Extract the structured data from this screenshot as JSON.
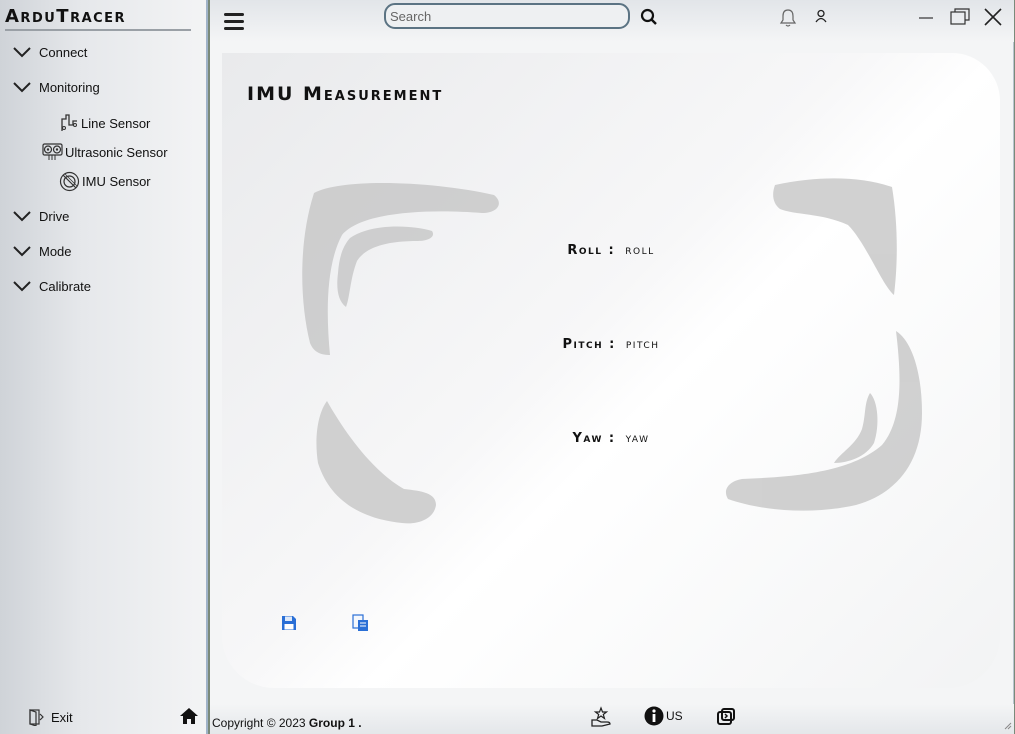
{
  "app": {
    "brand": "ArduTracer"
  },
  "sidebar": {
    "items": [
      {
        "label": "Connect",
        "icon": "chevron-down-icon"
      },
      {
        "label": "Monitoring",
        "icon": "chevron-down-icon"
      },
      {
        "label": "Drive",
        "icon": "chevron-down-icon"
      },
      {
        "label": "Mode",
        "icon": "chevron-down-icon"
      },
      {
        "label": "Calibrate",
        "icon": "chevron-down-icon"
      }
    ],
    "monitoring_sub": [
      {
        "label": "Line Sensor",
        "icon": "line-sensor-icon"
      },
      {
        "label": "Ultrasonic Sensor",
        "icon": "ultrasonic-sensor-icon"
      },
      {
        "label": "IMU Sensor",
        "icon": "imu-sensor-icon"
      }
    ],
    "exit_label": "Exit"
  },
  "topbar": {
    "search_placeholder": "Search",
    "search_value": ""
  },
  "panel": {
    "title": "IMU Measurement",
    "readings": [
      {
        "label": "Roll",
        "separator": ":",
        "value": "roll"
      },
      {
        "label": "Pitch",
        "separator": ":",
        "value": "pitch"
      },
      {
        "label": "Yaw",
        "separator": ":",
        "value": "yaw"
      }
    ]
  },
  "footer": {
    "copyright_prefix": "Copyright © 2023 ",
    "copyright_group": "Group 1 .",
    "locale": "US"
  },
  "colors": {
    "accent_blue": "#2a6fd6",
    "border": "#9fb3c8",
    "frame_gray": "#c8c8c8"
  }
}
